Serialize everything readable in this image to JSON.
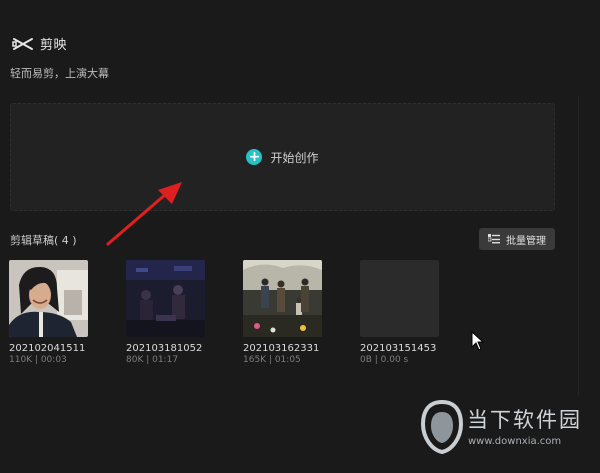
{
  "app": {
    "name": "剪映",
    "slogan": "轻而易剪，上演大幕"
  },
  "create": {
    "label": "开始创作"
  },
  "drafts_section": {
    "title": "剪辑草稿( 4 )",
    "batch_button_label": "批量管理",
    "items": [
      {
        "name": "202102041511",
        "meta": "110K | 00:03",
        "thumb": "person-selfie"
      },
      {
        "name": "202103181052",
        "meta": "80K | 01:17",
        "thumb": "dark-figures"
      },
      {
        "name": "202103162331",
        "meta": "165K | 01:05",
        "thumb": "family-scene"
      },
      {
        "name": "202103151453",
        "meta": "0B | 0.00 s",
        "thumb": "empty"
      }
    ]
  },
  "watermark": {
    "title": "当下软件园",
    "url": "www.downxia.com"
  },
  "colors": {
    "background": "#1a1a1a",
    "accent": "#25c3c9",
    "annotation_arrow": "#e02020"
  }
}
